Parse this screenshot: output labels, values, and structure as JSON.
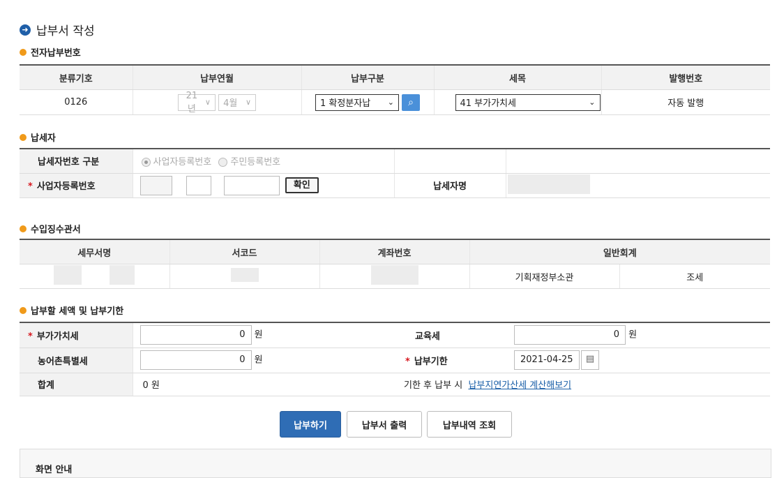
{
  "page_title": "납부서 작성",
  "sections": {
    "electronic": "전자납부번호",
    "taxpayer": "납세자",
    "office": "수입징수관서",
    "amount": "납부할 세액 및 납부기한"
  },
  "electronic_table": {
    "headers": [
      "분류기호",
      "납부연월",
      "납부구분",
      "세목",
      "발행번호"
    ],
    "code": "0126",
    "year": "21년",
    "month": "4월",
    "pay_type": "1 확정분자납",
    "tax_item": "41 부가가치세",
    "issue_no": "자동 발행"
  },
  "taxpayer_table": {
    "id_type_label": "납세자번호 구분",
    "radio_biz": "사업자등록번호",
    "radio_resident": "주민등록번호",
    "biz_no_label": "사업자등록번호",
    "confirm_btn": "확인",
    "name_label": "납세자명"
  },
  "office_table": {
    "headers": [
      "세무서명",
      "서코드",
      "계좌번호",
      "일반회계"
    ],
    "ministry": "기획재정부소관",
    "tax": "조세"
  },
  "amount_table": {
    "vat_label": "부가가치세",
    "vat_value": "0",
    "edu_label": "교육세",
    "edu_value": "0",
    "rural_label": "농어촌특별세",
    "rural_value": "0",
    "due_label": "납부기한",
    "due_value": "2021-04-25",
    "total_label": "합계",
    "total_value": "0 원",
    "after_due_text": "기한 후 납부 시",
    "after_due_link": "납부지연가산세 계산해보기",
    "unit": "원"
  },
  "buttons": {
    "pay": "납부하기",
    "print": "납부서 출력",
    "history": "납부내역 조회"
  },
  "bottom_text": "화면 안내",
  "colors": {
    "accent": "#2f6db5",
    "bullet": "#f09a1a",
    "required": "#d71920"
  }
}
